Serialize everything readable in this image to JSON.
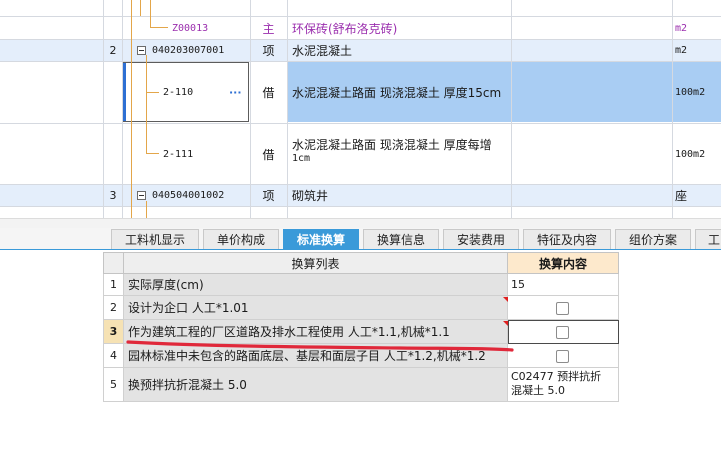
{
  "top_grid": {
    "rows": [
      {
        "num": "",
        "code": "Z00013",
        "cat": "主",
        "name": "环保砖(舒布洛克砖)",
        "unit": "m2"
      },
      {
        "num": "2",
        "code": "040203007001",
        "cat": "项",
        "name": "水泥混凝土",
        "unit": "m2"
      },
      {
        "num": "",
        "code": "2-110",
        "ellipsis": "···",
        "cat": "借",
        "name": "水泥混凝土路面 现浇混凝土 厚度15cm",
        "unit": "100m2"
      },
      {
        "num": "",
        "code": "2-111",
        "cat": "借",
        "name_line1": "水泥混凝土路面 现浇混凝土 厚度每增",
        "name_line2": "1cm",
        "unit": "100m2"
      },
      {
        "num": "3",
        "code": "040504001002",
        "cat": "项",
        "name": "砌筑井",
        "unit": "座"
      }
    ]
  },
  "tabs": [
    {
      "label": "工料机显示"
    },
    {
      "label": "单价构成"
    },
    {
      "label": "标准换算",
      "active": true
    },
    {
      "label": "换算信息"
    },
    {
      "label": "安装费用"
    },
    {
      "label": "特征及内容"
    },
    {
      "label": "组价方案"
    },
    {
      "label": "工"
    }
  ],
  "conversion_table": {
    "header_list": "换算列表",
    "header_content": "换算内容",
    "rows": [
      {
        "num": "1",
        "text": "实际厚度(cm)",
        "content": "15",
        "has_checkbox": false
      },
      {
        "num": "2",
        "text": "设计为企口 人工*1.01",
        "content": "",
        "has_checkbox": true,
        "checked": false
      },
      {
        "num": "3",
        "text": "作为建筑工程的厂区道路及排水工程使用 人工*1.1,机械*1.1",
        "content": "",
        "has_checkbox": true,
        "checked": false
      },
      {
        "num": "4",
        "text": "园林标准中未包含的路面底层、基层和面层子目 人工*1.2,机械*1.2",
        "content": "",
        "has_checkbox": true,
        "checked": false
      },
      {
        "num": "5",
        "text": "换预拌抗折混凝土 5.0",
        "content_line1": "C02477  预拌抗折",
        "content_line2": "混凝土 5.0",
        "has_checkbox": false
      }
    ]
  },
  "colors": {
    "selected_row": "#a9cdf3",
    "group_row": "#e4eefb",
    "active_tab": "#3a9ad9",
    "header_content_bg": "#fde9cc",
    "purple_text": "#9b2fae",
    "annotation_red": "#e0283a"
  }
}
